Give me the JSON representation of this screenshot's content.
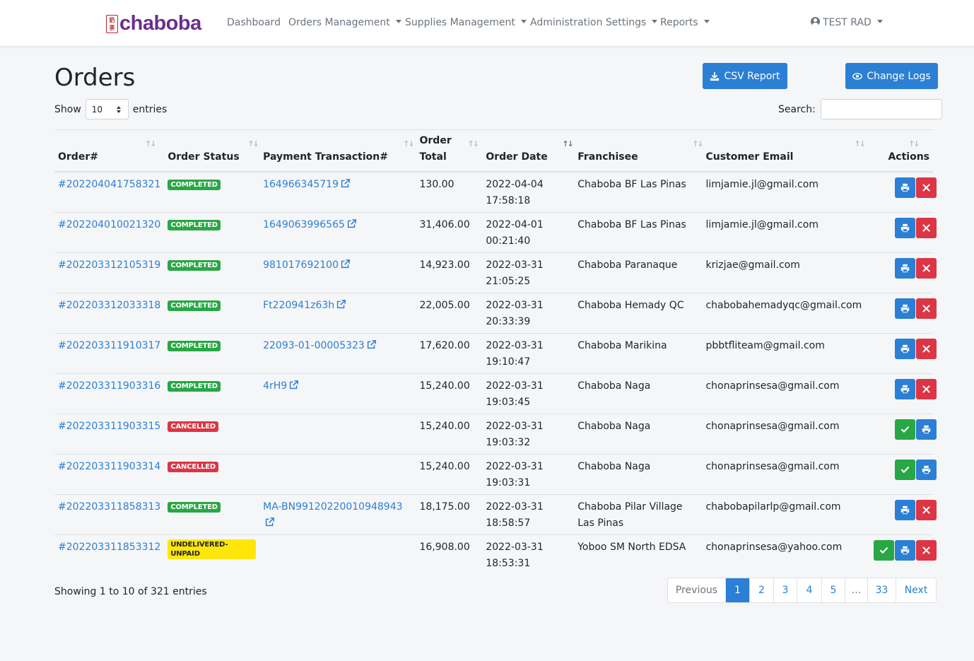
{
  "brand": {
    "seal_text": "奶茶",
    "name": "chaboba"
  },
  "nav": {
    "items": [
      {
        "label": "Dashboard",
        "dropdown": false
      },
      {
        "label": "Orders Management",
        "dropdown": true
      },
      {
        "label": "Supplies Management",
        "dropdown": true
      },
      {
        "label": "Administration Settings",
        "dropdown": true
      },
      {
        "label": "Reports",
        "dropdown": true
      }
    ],
    "user": "TEST RAD"
  },
  "page": {
    "title": "Orders",
    "csv_button": "CSV Report",
    "changelog_button": "Change Logs"
  },
  "controls": {
    "show_label": "Show",
    "page_size": "10",
    "entries_label": "entries",
    "search_label": "Search:",
    "search_value": ""
  },
  "table": {
    "columns": [
      "Order#",
      "Order Status",
      "Payment Transaction#",
      "Order Total",
      "Order Date",
      "Franchisee",
      "Customer Email",
      "Actions"
    ],
    "rows": [
      {
        "order": "#202204041758321",
        "status": "COMPLETED",
        "txn": "164966345719",
        "total": "130.00",
        "date": "2022-04-04",
        "time": "17:58:18",
        "franchisee": "Chaboba BF Las Pinas",
        "email": "limjamie.jl@gmail.com",
        "actions": [
          "print",
          "delete"
        ]
      },
      {
        "order": "#202204010021320",
        "status": "COMPLETED",
        "txn": "1649063996565",
        "total": "31,406.00",
        "date": "2022-04-01",
        "time": "00:21:40",
        "franchisee": "Chaboba BF Las Pinas",
        "email": "limjamie.jl@gmail.com",
        "actions": [
          "print",
          "delete"
        ]
      },
      {
        "order": "#202203312105319",
        "status": "COMPLETED",
        "txn": "981017692100",
        "total": "14,923.00",
        "date": "2022-03-31",
        "time": "21:05:25",
        "franchisee": "Chaboba Paranaque",
        "email": "krizjae@gmail.com",
        "actions": [
          "print",
          "delete"
        ]
      },
      {
        "order": "#202203312033318",
        "status": "COMPLETED",
        "txn": "Ft220941z63h",
        "total": "22,005.00",
        "date": "2022-03-31",
        "time": "20:33:39",
        "franchisee": "Chaboba Hemady QC",
        "email": "chabobahemadyqc@gmail.com",
        "actions": [
          "print",
          "delete"
        ]
      },
      {
        "order": "#202203311910317",
        "status": "COMPLETED",
        "txn": "22093-01-00005323",
        "total": "17,620.00",
        "date": "2022-03-31",
        "time": "19:10:47",
        "franchisee": "Chaboba Marikina",
        "email": "pbbtfliteam@gmail.com",
        "actions": [
          "print",
          "delete"
        ]
      },
      {
        "order": "#202203311903316",
        "status": "COMPLETED",
        "txn": "4rH9",
        "total": "15,240.00",
        "date": "2022-03-31",
        "time": "19:03:45",
        "franchisee": "Chaboba Naga",
        "email": "chonaprinsesa@gmail.com",
        "actions": [
          "print",
          "delete"
        ]
      },
      {
        "order": "#202203311903315",
        "status": "CANCELLED",
        "txn": "",
        "total": "15,240.00",
        "date": "2022-03-31",
        "time": "19:03:32",
        "franchisee": "Chaboba Naga",
        "email": "chonaprinsesa@gmail.com",
        "actions": [
          "approve",
          "print"
        ]
      },
      {
        "order": "#202203311903314",
        "status": "CANCELLED",
        "txn": "",
        "total": "15,240.00",
        "date": "2022-03-31",
        "time": "19:03:31",
        "franchisee": "Chaboba Naga",
        "email": "chonaprinsesa@gmail.com",
        "actions": [
          "approve",
          "print"
        ]
      },
      {
        "order": "#202203311858313",
        "status": "COMPLETED",
        "txn": "MA-BN99120220010948943",
        "total": "18,175.00",
        "date": "2022-03-31",
        "time": "18:58:57",
        "franchisee": "Chaboba Pilar Village Las Pinas",
        "email": "chabobapilarlp@gmail.com",
        "actions": [
          "print",
          "delete"
        ]
      },
      {
        "order": "#202203311853312",
        "status": "UNDELIVERED-UNPAID",
        "txn": "",
        "total": "16,908.00",
        "date": "2022-03-31",
        "time": "18:53:31",
        "franchisee": "Yoboo SM North EDSA",
        "email": "chonaprinsesa@yahoo.com",
        "actions": [
          "approve",
          "print",
          "delete"
        ]
      }
    ]
  },
  "footer": {
    "info": "Showing 1 to 10 of 321 entries",
    "pages": [
      {
        "label": "Previous",
        "state": "disabled"
      },
      {
        "label": "1",
        "state": "active"
      },
      {
        "label": "2",
        "state": ""
      },
      {
        "label": "3",
        "state": ""
      },
      {
        "label": "4",
        "state": ""
      },
      {
        "label": "5",
        "state": ""
      },
      {
        "label": "…",
        "state": "disabled"
      },
      {
        "label": "33",
        "state": ""
      },
      {
        "label": "Next",
        "state": ""
      }
    ]
  },
  "colors": {
    "primary": "#2b7fd4",
    "success": "#28a745",
    "danger": "#dc3545",
    "warning": "#ffe60a",
    "brand": "#6b2e8f"
  }
}
